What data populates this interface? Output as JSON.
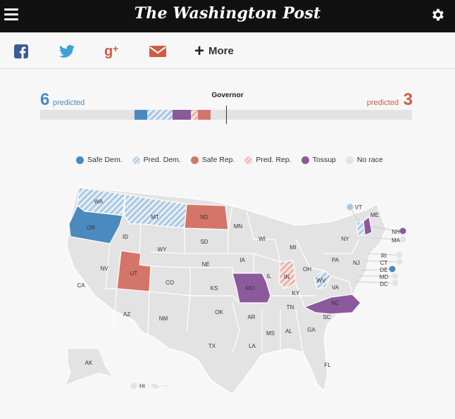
{
  "header": {
    "logo": "The Washington Post",
    "menu_icon": "hamburger-icon",
    "settings_icon": "gear-icon"
  },
  "share": {
    "icons": [
      "facebook-icon",
      "twitter-icon",
      "google-plus-icon",
      "email-icon"
    ],
    "more_label": "More"
  },
  "race": {
    "title": "Governor",
    "dem_count": "6",
    "rep_count": "3",
    "dem_predicted_label": "predicted",
    "rep_predicted_label": "predicted"
  },
  "colors": {
    "safe_dem": "#4b8abe",
    "pred_dem": "#a9c8e2",
    "safe_rep": "#d4756a",
    "pred_rep": "#ecb1aa",
    "tossup": "#8c5a9c",
    "no_race": "#e3e3e3"
  },
  "legend": {
    "safe_dem": "Safe Dem.",
    "pred_dem": "Pred. Dem.",
    "safe_rep": "Safe Rep.",
    "pred_rep": "Pred. Rep.",
    "tossup": "Tossup",
    "no_race": "No race"
  },
  "map": {
    "states": {
      "WA": "WA",
      "OR": "OR",
      "ID": "ID",
      "MT": "MT",
      "ND": "ND",
      "MN": "MN",
      "WI": "WI",
      "MI": "MI",
      "NY": "NY",
      "VT": "VT",
      "NH": "NH",
      "ME": "ME",
      "MA": "MA",
      "RI": "RI",
      "CT": "CT",
      "NJ": "NJ",
      "DE": "DE",
      "MD": "MD",
      "DC": "DC",
      "PA": "PA",
      "OH": "OH",
      "IN": "IN",
      "IL": "IL",
      "IA": "IA",
      "NE": "NE",
      "SD": "SD",
      "WY": "WY",
      "NV": "NV",
      "UT": "UT",
      "CO": "CO",
      "CA": "CA",
      "AZ": "AZ",
      "NM": "NM",
      "KS": "KS",
      "MO": "MO",
      "OK": "OK",
      "TX": "TX",
      "AR": "AR",
      "LA": "LA",
      "MS": "MS",
      "AL": "AL",
      "GA": "GA",
      "FL": "FL",
      "SC": "SC",
      "NC": "NC",
      "TN": "TN",
      "KY": "KY",
      "WV": "WV",
      "VA": "VA",
      "AK": "AK",
      "HI": "HI"
    }
  }
}
